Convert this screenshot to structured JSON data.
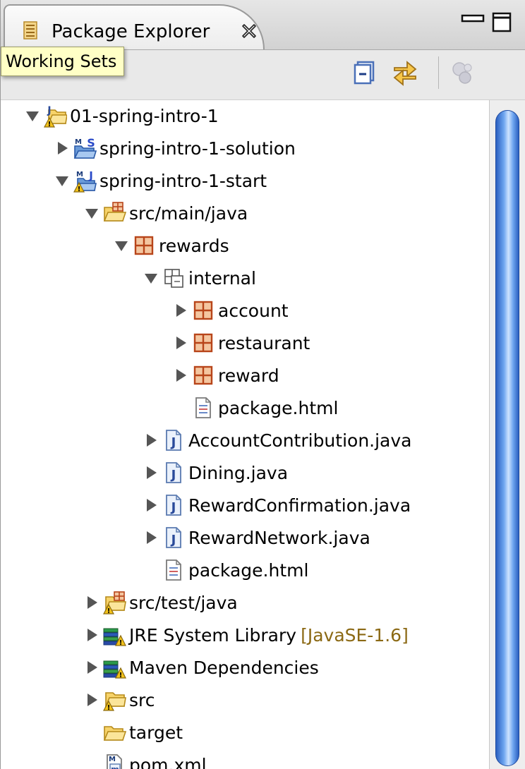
{
  "view": {
    "title": "Package Explorer",
    "tooltip": "Working Sets",
    "icons": {
      "tab": "package-explorer-icon",
      "close": "close-x-icon",
      "minimize": "minimize-icon",
      "maximize": "maximize-icon",
      "collapse_all": "collapse-all-icon",
      "link_editor": "link-with-editor-icon",
      "focus": "focus-on-active-task-icon",
      "view_menu": "view-menu-triangle-icon"
    }
  },
  "tree": [
    {
      "label": "01-spring-intro-1",
      "icon": "working-set-folder-warning-icon",
      "expanded": true
    },
    {
      "label": "spring-intro-1-solution",
      "icon": "maven-project-icon",
      "expanded": false
    },
    {
      "label": "spring-intro-1-start",
      "icon": "maven-java-project-warning-icon",
      "expanded": true
    },
    {
      "label": "src/main/java",
      "icon": "source-folder-icon",
      "expanded": true
    },
    {
      "label": "rewards",
      "icon": "package-icon",
      "expanded": true
    },
    {
      "label": "internal",
      "icon": "package-outline-icon",
      "expanded": true
    },
    {
      "label": "account",
      "icon": "package-icon",
      "expanded": false
    },
    {
      "label": "restaurant",
      "icon": "package-icon",
      "expanded": false
    },
    {
      "label": "reward",
      "icon": "package-icon",
      "expanded": false
    },
    {
      "label": "package.html",
      "icon": "html-file-icon",
      "expanded": null
    },
    {
      "label": "AccountContribution.java",
      "icon": "java-file-icon",
      "expanded": false
    },
    {
      "label": "Dining.java",
      "icon": "java-file-icon",
      "expanded": false
    },
    {
      "label": "RewardConfirmation.java",
      "icon": "java-file-icon",
      "expanded": false
    },
    {
      "label": "RewardNetwork.java",
      "icon": "java-file-icon",
      "expanded": false
    },
    {
      "label": "package.html",
      "icon": "html-file-icon",
      "expanded": null
    },
    {
      "label": "src/test/java",
      "icon": "source-folder-warning-icon",
      "expanded": false
    },
    {
      "label": "JRE System Library",
      "decoration": "[JavaSE-1.6]",
      "icon": "library-warning-icon",
      "expanded": false
    },
    {
      "label": "Maven Dependencies",
      "icon": "library-warning-icon",
      "expanded": false
    },
    {
      "label": "src",
      "icon": "folder-warning-icon",
      "expanded": false
    },
    {
      "label": "target",
      "icon": "folder-icon",
      "expanded": null
    },
    {
      "label": "pom.xml",
      "icon": "maven-pom-icon",
      "expanded": null
    }
  ],
  "colors": {
    "scroll_thumb": "#4a86e0",
    "tooltip_bg": "#ffffc6",
    "package_icon": "#b8451a",
    "folder_icon": "#f0b838",
    "decoration_text": "#8b6914"
  }
}
